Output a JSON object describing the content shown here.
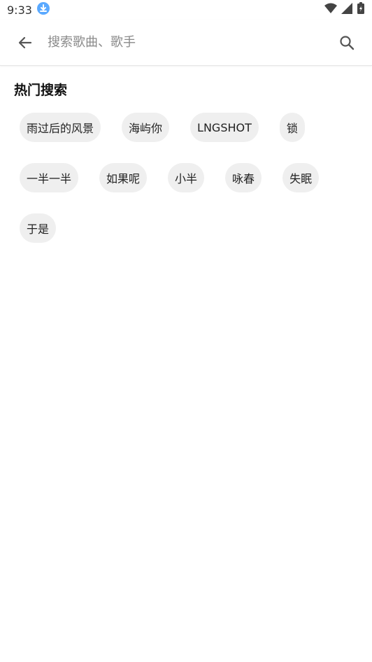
{
  "status_bar": {
    "time": "9:33"
  },
  "search": {
    "placeholder": "搜索歌曲、歌手"
  },
  "hot_search": {
    "title": "热门搜索",
    "tags": [
      "雨过后的风景",
      "海屿你",
      "LNGSHOT",
      "锁",
      "一半一半",
      "如果呢",
      "小半",
      "咏春",
      "失眠",
      "于是"
    ]
  },
  "colors": {
    "tag_bg": "#efefef",
    "text": "#111111",
    "placeholder": "#8a8a8a",
    "download_icon": "#5aa9ff"
  }
}
